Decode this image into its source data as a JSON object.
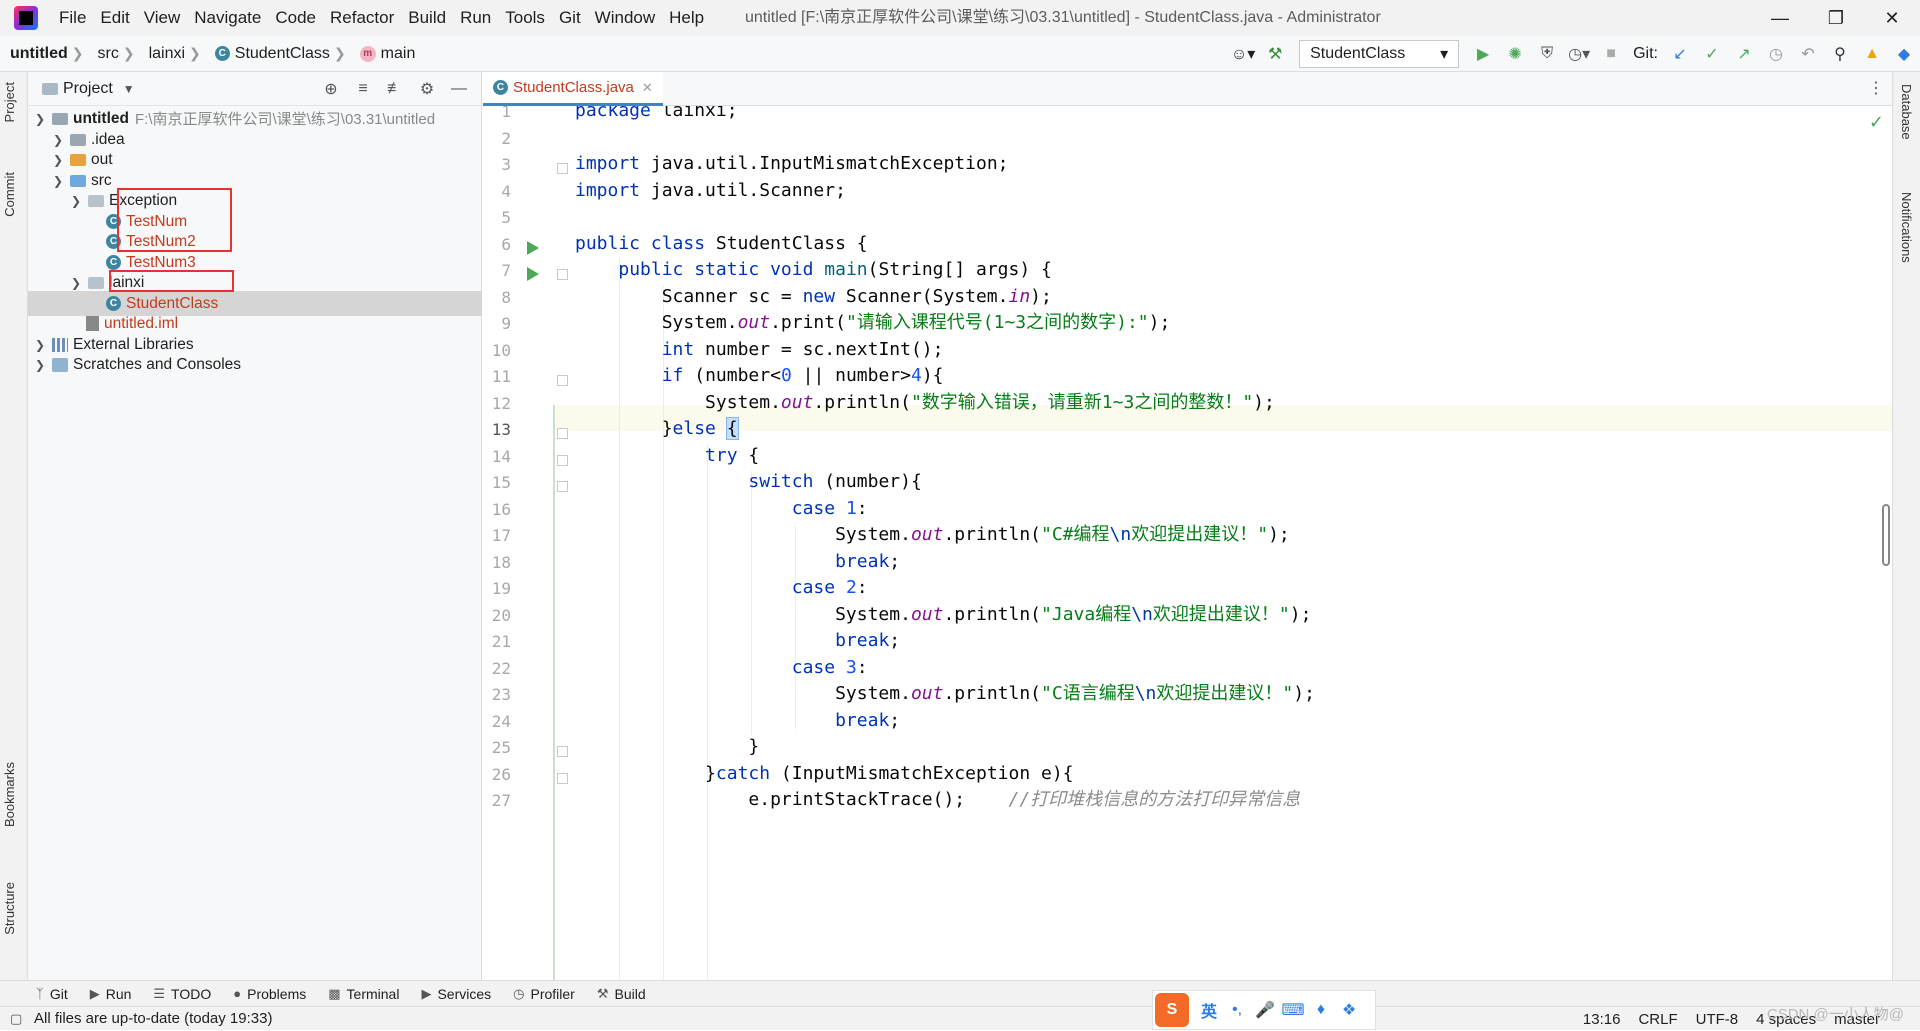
{
  "menubar": {
    "items": [
      "File",
      "Edit",
      "View",
      "Navigate",
      "Code",
      "Refactor",
      "Build",
      "Run",
      "Tools",
      "Git",
      "Window",
      "Help"
    ],
    "title": "untitled [F:\\南京正厚软件公司\\课堂\\练习\\03.31\\untitled] - StudentClass.java - Administrator"
  },
  "breadcrumbs": [
    "untitled",
    "src",
    "lainxi",
    "StudentClass",
    "main"
  ],
  "toolbar": {
    "run_config": "StudentClass",
    "git_label": "Git:"
  },
  "side_tabs": {
    "left": [
      "Project",
      "Commit",
      "Bookmarks",
      "Structure"
    ],
    "right": [
      "Database",
      "Notifications"
    ]
  },
  "project_panel": {
    "title": "Project",
    "tree": [
      {
        "label": "untitled",
        "hint": "F:\\南京正厚软件公司\\课堂\\练习\\03.31\\untitled",
        "depth": 0,
        "icon": "module-folder-icon",
        "expanded": true
      },
      {
        "label": ".idea",
        "depth": 1,
        "icon": "folder-icon",
        "expanded": false
      },
      {
        "label": "out",
        "depth": 1,
        "icon": "excluded-folder-icon",
        "expanded": false
      },
      {
        "label": "src",
        "depth": 1,
        "icon": "source-folder-icon",
        "expanded": true
      },
      {
        "label": "Exception",
        "depth": 2,
        "icon": "package-icon",
        "expanded": true
      },
      {
        "label": "TestNum",
        "depth": 3,
        "icon": "java-class-icon"
      },
      {
        "label": "TestNum2",
        "depth": 3,
        "icon": "java-class-icon"
      },
      {
        "label": "TestNum3",
        "depth": 3,
        "icon": "java-class-icon"
      },
      {
        "label": "lainxi",
        "depth": 2,
        "icon": "package-icon",
        "expanded": true
      },
      {
        "label": "StudentClass",
        "depth": 3,
        "icon": "java-class-icon",
        "selected": true
      },
      {
        "label": "untitled.iml",
        "depth": 2,
        "icon": "iml-file-icon"
      },
      {
        "label": "External Libraries",
        "depth": 0,
        "icon": "library-icon",
        "expanded": false
      },
      {
        "label": "Scratches and Consoles",
        "depth": 0,
        "icon": "scratches-icon",
        "expanded": false
      }
    ]
  },
  "editor": {
    "tab_label": "StudentClass.java",
    "current_line": 13,
    "line_numbers": [
      "1",
      "2",
      "3",
      "4",
      "5",
      "6",
      "7",
      "8",
      "9",
      "10",
      "11",
      "12",
      "13",
      "14",
      "15",
      "16",
      "17",
      "18",
      "19",
      "20",
      "21",
      "22",
      "23",
      "24",
      "25",
      "26",
      "27"
    ]
  },
  "bottom_tools": [
    "Git",
    "Run",
    "TODO",
    "Problems",
    "Terminal",
    "Services",
    "Profiler",
    "Build"
  ],
  "status": {
    "message": "All files are up-to-date (today 19:33)",
    "position": "13:16",
    "line_sep": "CRLF",
    "encoding": "UTF-8",
    "indent": "4 spaces",
    "branch": "master"
  },
  "ime": {
    "lang": "英",
    "punct": "•,"
  },
  "watermark": "CSDN @一小人物@",
  "colors": {
    "keyword": "#0033b3",
    "string": "#067d17",
    "number": "#1750eb",
    "field": "#871094",
    "comment": "#8c8c8c",
    "highlight_box": "#e53333"
  }
}
